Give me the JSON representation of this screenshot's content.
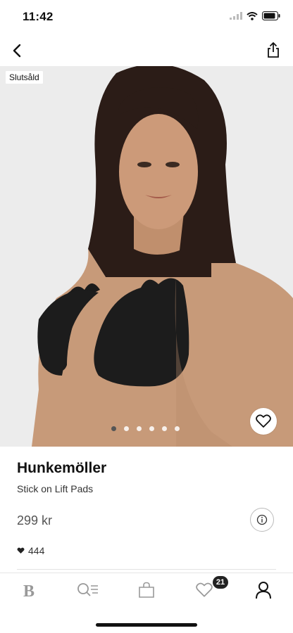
{
  "status_bar": {
    "time": "11:42"
  },
  "product": {
    "badge": "Slutsåld",
    "brand": "Hunkemöller",
    "name": "Stick on Lift Pads",
    "price": "299 kr",
    "likes": "444",
    "image_pages": 6,
    "active_page": 1
  },
  "tab_bar": {
    "items": [
      "home-logo-icon",
      "search-list-icon",
      "shopping-bag-icon",
      "heart-icon",
      "profile-icon"
    ],
    "favorites_count": "21",
    "active": "profile"
  },
  "colors": {
    "accent": "#111111",
    "badge_bg": "#222222",
    "price": "#555555"
  }
}
